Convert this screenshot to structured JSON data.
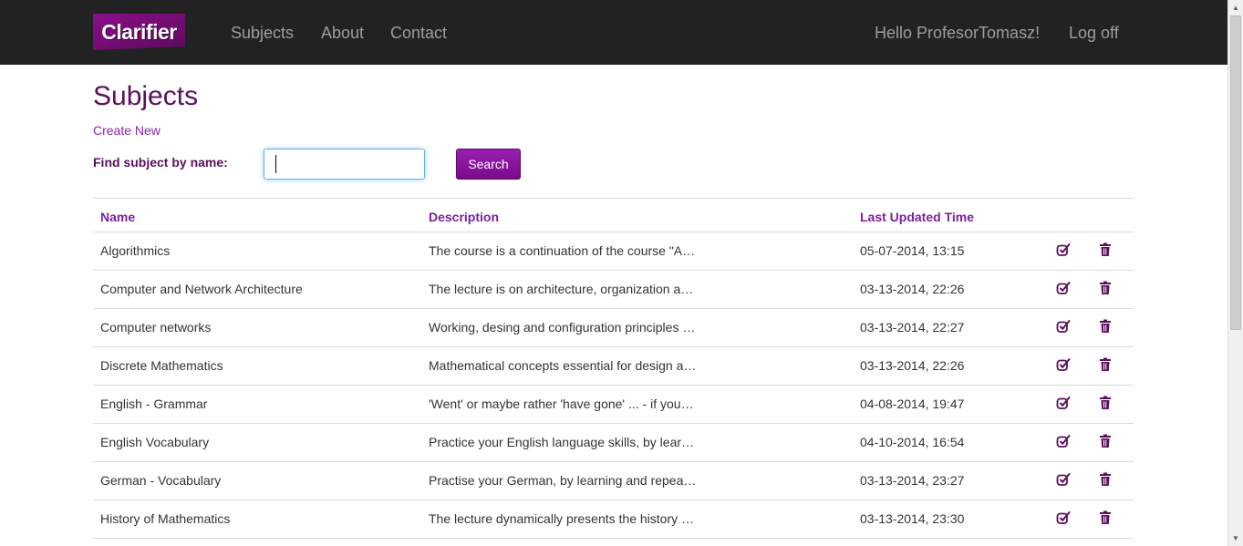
{
  "brand": {
    "logo_text": "Clarifier"
  },
  "nav": {
    "links": [
      "Subjects",
      "About",
      "Contact"
    ],
    "greeting": "Hello ProfesorTomasz!",
    "logoff": "Log off"
  },
  "page": {
    "title": "Subjects",
    "create_new": "Create New",
    "find_label": "Find subject by name:",
    "search_value": "",
    "search_button": "Search"
  },
  "table": {
    "headers": [
      "Name",
      "Description",
      "Last Updated Time"
    ],
    "rows": [
      {
        "name": "Algorithmics",
        "description": "The course is a continuation of the course \"A…",
        "updated": "05-07-2014, 13:15"
      },
      {
        "name": "Computer and Network Architecture",
        "description": "The lecture is on architecture, organization a…",
        "updated": "03-13-2014, 22:26"
      },
      {
        "name": "Computer networks",
        "description": "Working, desing and configuration principles …",
        "updated": "03-13-2014, 22:27"
      },
      {
        "name": "Discrete Mathematics",
        "description": "Mathematical concepts essential for design a…",
        "updated": "03-13-2014, 22:26"
      },
      {
        "name": "English - Grammar",
        "description": "'Went' or maybe rather 'have gone' ... - if you…",
        "updated": "04-08-2014, 19:47"
      },
      {
        "name": "English Vocabulary",
        "description": "Practice your English language skills, by lear…",
        "updated": "04-10-2014, 16:54"
      },
      {
        "name": "German - Vocabulary",
        "description": "Practise your German, by learning and repea…",
        "updated": "03-13-2014, 23:27"
      },
      {
        "name": "History of Mathematics",
        "description": "The lecture dynamically presents the history …",
        "updated": "03-13-2014, 23:30"
      }
    ],
    "row_icons": [
      "edit-icon",
      "trash-icon"
    ]
  },
  "colors": {
    "navbar": "#222222",
    "brand_purple": "#5c0f5c",
    "link_purple": "#8e24aa",
    "header_purple": "#7b1fa2",
    "icon_purple": "#5c0f5c"
  }
}
